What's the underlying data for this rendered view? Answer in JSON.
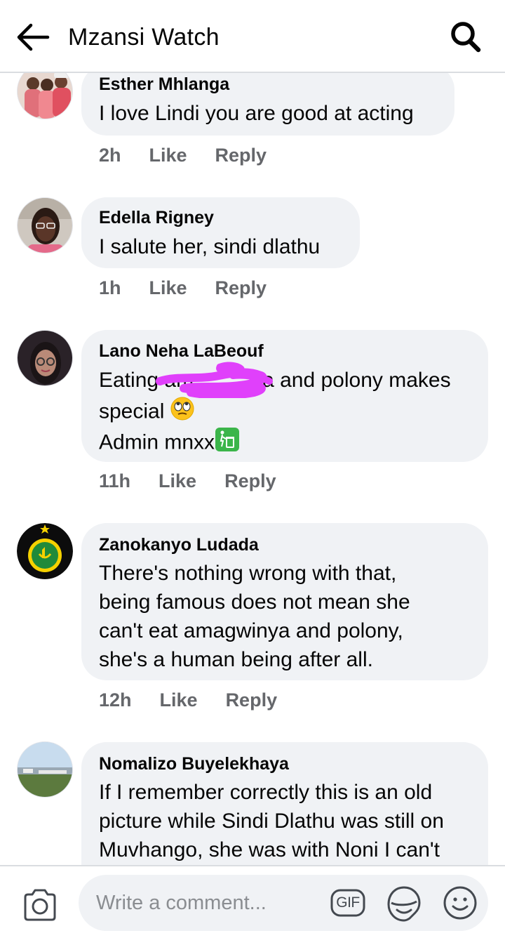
{
  "header": {
    "title": "Mzansi Watch",
    "back_icon": "arrow-left-icon",
    "search_icon": "search-icon"
  },
  "comments": [
    {
      "author": "Esther Mhlanga",
      "lines": [
        "I love Lindi you are good at acting"
      ],
      "time": "2h",
      "like": "Like",
      "reply": "Reply"
    },
    {
      "author": "Edella Rigney",
      "lines": [
        "I salute her, sindi dlathu"
      ],
      "time": "1h",
      "like": "Like",
      "reply": "Reply"
    },
    {
      "author": "Lano Neha LaBeouf",
      "lines": [
        "Eating am",
        "a and polony makes",
        "special",
        "Admin mnxx"
      ],
      "emoji": [
        "face-with-rolling-eyes-emoji",
        "put-litter-in-its-place-emoji"
      ],
      "time": "11h",
      "like": "Like",
      "reply": "Reply"
    },
    {
      "author": "Zanokanyo Ludada",
      "lines": [
        "There's nothing wrong with that,",
        "being famous does not mean she",
        "can't eat amagwinya and polony,",
        "she's a human being after all."
      ],
      "time": "12h",
      "like": "Like",
      "reply": "Reply"
    },
    {
      "author": "Nomalizo Buyelekhaya",
      "lines": [
        "If I remember correctly this is an old",
        "picture while Sindi Dlathu was still on",
        "Muvhango, she was with Noni I can't"
      ]
    }
  ],
  "composer": {
    "placeholder": "Write a comment...",
    "camera_icon": "camera-icon",
    "gif_icon": "gif-icon",
    "gif_label": "GIF",
    "sticker_icon": "sticker-icon",
    "emoji_icon": "smiley-icon"
  },
  "colors": {
    "bubble": "#f0f2f5",
    "meta_text": "#65676b",
    "divider": "#dadde1",
    "scribble": "#e040fb"
  }
}
